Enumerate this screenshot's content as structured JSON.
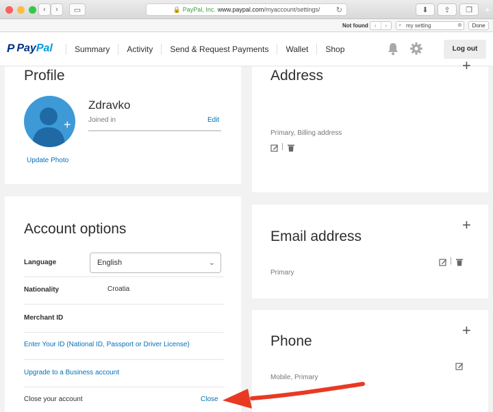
{
  "browser": {
    "url_secure_label": "PayPal, Inc.",
    "url_domain": "www.paypal.com",
    "url_path": "/myaccount/settings/",
    "find_status": "Not found",
    "find_query": "my setting",
    "find_done": "Done"
  },
  "nav": {
    "logo_pay": "Pay",
    "logo_pal": "Pal",
    "items": [
      "Summary",
      "Activity",
      "Send & Request Payments",
      "Wallet",
      "Shop"
    ],
    "logout": "Log out"
  },
  "profile": {
    "title": "Profile",
    "name": "Zdravko",
    "joined": "Joined in",
    "edit": "Edit",
    "update_photo": "Update Photo"
  },
  "address": {
    "title": "Address",
    "caption": "Primary, Billing address"
  },
  "account_options": {
    "title": "Account options",
    "language_label": "Language",
    "language_value": "English",
    "nationality_label": "Nationality",
    "nationality_value": "Croatia",
    "merchant_label": "Merchant ID",
    "enter_id_link": "Enter Your ID (National ID, Passport or Driver License)",
    "upgrade_link": "Upgrade to a Business account",
    "close_label": "Close your account",
    "close_link": "Close"
  },
  "email": {
    "title": "Email address",
    "caption": "Primary"
  },
  "phone": {
    "title": "Phone",
    "caption": "Mobile, Primary"
  },
  "colors": {
    "link": "#0070ba",
    "avatar": "#3d9ad7",
    "arrow": "#e83a23"
  }
}
